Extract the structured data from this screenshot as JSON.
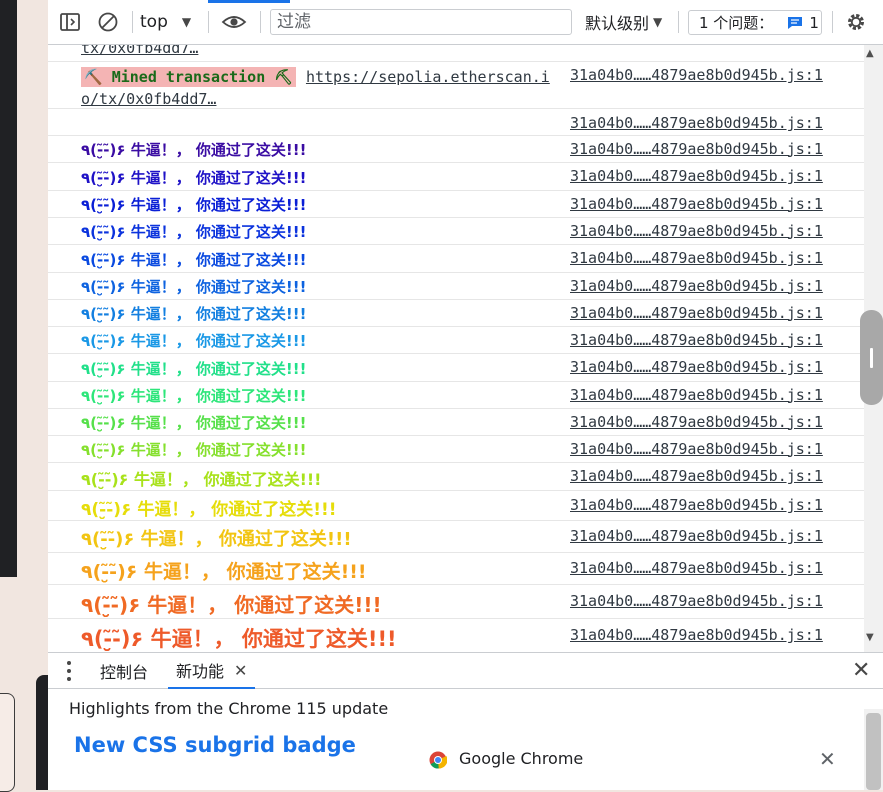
{
  "toolbar": {
    "context": "top",
    "filter_placeholder": "过滤",
    "levels": "默认级别",
    "issues_label": "1 个问题：",
    "issues_count": "1"
  },
  "console": {
    "partial_link": "tx/0x0fb4dd7…",
    "mined_label": "⛏️ Mined transaction ⛏",
    "mined_link_line1": "https://sepolia.etherscan.i",
    "mined_link_line2": "o/tx/0x0fb4dd7…",
    "source": "31a04b0……4879ae8b0d945b.js:1",
    "fancy_text": "٩(-̮̮̃-̃)۶ 牛逼！， 你通过了这关!!!",
    "fancy_rows": [
      {
        "color": "#3a0ca3"
      },
      {
        "color": "#1f12c7"
      },
      {
        "color": "#0a1fd6"
      },
      {
        "color": "#0b33dd"
      },
      {
        "color": "#0a4ae0"
      },
      {
        "color": "#0e63e0"
      },
      {
        "color": "#137fe0"
      },
      {
        "color": "#1a98e6"
      },
      {
        "color": "#21e08a"
      },
      {
        "color": "#2de67a"
      },
      {
        "color": "#56e04a"
      },
      {
        "color": "#85e02d"
      },
      {
        "color": "#a8e21a"
      },
      {
        "color": "#e6dd0a"
      },
      {
        "color": "#f2c512"
      },
      {
        "color": "#f5a21c"
      },
      {
        "color": "#f06a24"
      },
      {
        "color": "#ee5a2a"
      }
    ]
  },
  "drawer": {
    "tab_console": "控制台",
    "tab_whatsnew": "新功能"
  },
  "whatsnew": {
    "highlights": "Highlights from the Chrome 115 update",
    "card_title": "New CSS subgrid badge",
    "notif_title": "Google Chrome"
  }
}
